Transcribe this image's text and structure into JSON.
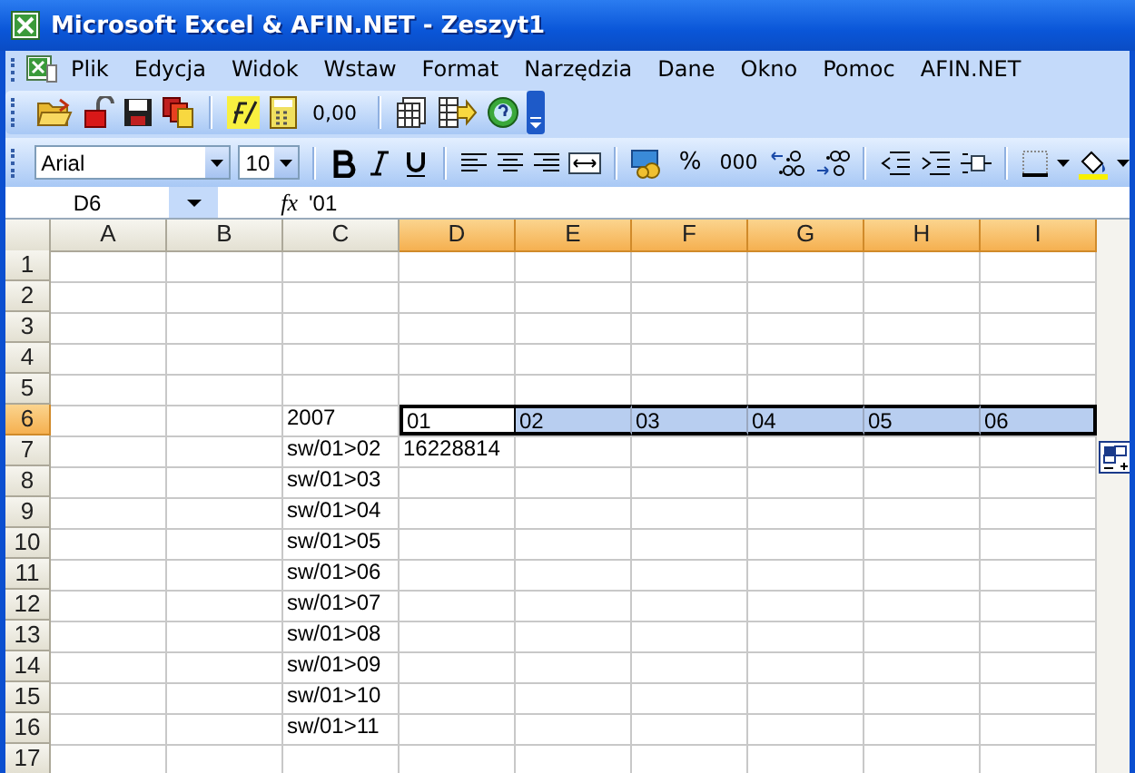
{
  "window": {
    "title": "Microsoft Excel & AFIN.NET - Zeszyt1"
  },
  "menu": [
    {
      "label": "Plik"
    },
    {
      "label": "Edycja"
    },
    {
      "label": "Widok"
    },
    {
      "label": "Wstaw"
    },
    {
      "label": "Format"
    },
    {
      "label": "Narzędzia"
    },
    {
      "label": "Dane"
    },
    {
      "label": "Okno"
    },
    {
      "label": "Pomoc"
    },
    {
      "label": "AFIN.NET"
    }
  ],
  "standard_toolbar": {
    "number_button": "0,00"
  },
  "formatting_toolbar": {
    "font": "Arial",
    "size": "10",
    "percent_button": "%",
    "thousands_button": "000"
  },
  "formula_bar": {
    "name_box": "D6",
    "function_label": "fx",
    "formula": "'01"
  },
  "sheet": {
    "columns": [
      {
        "label": "A",
        "selected": false
      },
      {
        "label": "B",
        "selected": false
      },
      {
        "label": "C",
        "selected": false
      },
      {
        "label": "D",
        "selected": true
      },
      {
        "label": "E",
        "selected": true
      },
      {
        "label": "F",
        "selected": true
      },
      {
        "label": "G",
        "selected": true
      },
      {
        "label": "H",
        "selected": true
      },
      {
        "label": "I",
        "selected": true
      }
    ],
    "rows": [
      {
        "label": "1",
        "selected": false,
        "cells": []
      },
      {
        "label": "2",
        "selected": false,
        "cells": []
      },
      {
        "label": "3",
        "selected": false,
        "cells": []
      },
      {
        "label": "4",
        "selected": false,
        "cells": []
      },
      {
        "label": "5",
        "selected": false,
        "cells": []
      },
      {
        "label": "6",
        "selected": true,
        "cells": [
          null,
          null,
          {
            "text": "2007",
            "selected": false,
            "active": false
          },
          {
            "text": "01",
            "selected": true,
            "active": true
          },
          {
            "text": "02",
            "selected": true,
            "active": false
          },
          {
            "text": "03",
            "selected": true,
            "active": false
          },
          {
            "text": "04",
            "selected": true,
            "active": false
          },
          {
            "text": "05",
            "selected": true,
            "active": false
          },
          {
            "text": "06",
            "selected": true,
            "active": false
          }
        ]
      },
      {
        "label": "7",
        "selected": false,
        "cells": [
          null,
          null,
          {
            "text": "sw/01>02",
            "selected": false,
            "active": false
          },
          {
            "text": "16228814",
            "selected": false,
            "active": false
          }
        ]
      },
      {
        "label": "8",
        "selected": false,
        "cells": [
          null,
          null,
          {
            "text": "sw/01>03",
            "selected": false,
            "active": false
          }
        ]
      },
      {
        "label": "9",
        "selected": false,
        "cells": [
          null,
          null,
          {
            "text": "sw/01>04",
            "selected": false,
            "active": false
          }
        ]
      },
      {
        "label": "10",
        "selected": false,
        "cells": [
          null,
          null,
          {
            "text": "sw/01>05",
            "selected": false,
            "active": false
          }
        ]
      },
      {
        "label": "11",
        "selected": false,
        "cells": [
          null,
          null,
          {
            "text": "sw/01>06",
            "selected": false,
            "active": false
          }
        ]
      },
      {
        "label": "12",
        "selected": false,
        "cells": [
          null,
          null,
          {
            "text": "sw/01>07",
            "selected": false,
            "active": false
          }
        ]
      },
      {
        "label": "13",
        "selected": false,
        "cells": [
          null,
          null,
          {
            "text": "sw/01>08",
            "selected": false,
            "active": false
          }
        ]
      },
      {
        "label": "14",
        "selected": false,
        "cells": [
          null,
          null,
          {
            "text": "sw/01>09",
            "selected": false,
            "active": false
          }
        ]
      },
      {
        "label": "15",
        "selected": false,
        "cells": [
          null,
          null,
          {
            "text": "sw/01>10",
            "selected": false,
            "active": false
          }
        ]
      },
      {
        "label": "16",
        "selected": false,
        "cells": [
          null,
          null,
          {
            "text": "sw/01>11",
            "selected": false,
            "active": false
          }
        ]
      },
      {
        "label": "17",
        "selected": false,
        "cells": []
      }
    ]
  }
}
